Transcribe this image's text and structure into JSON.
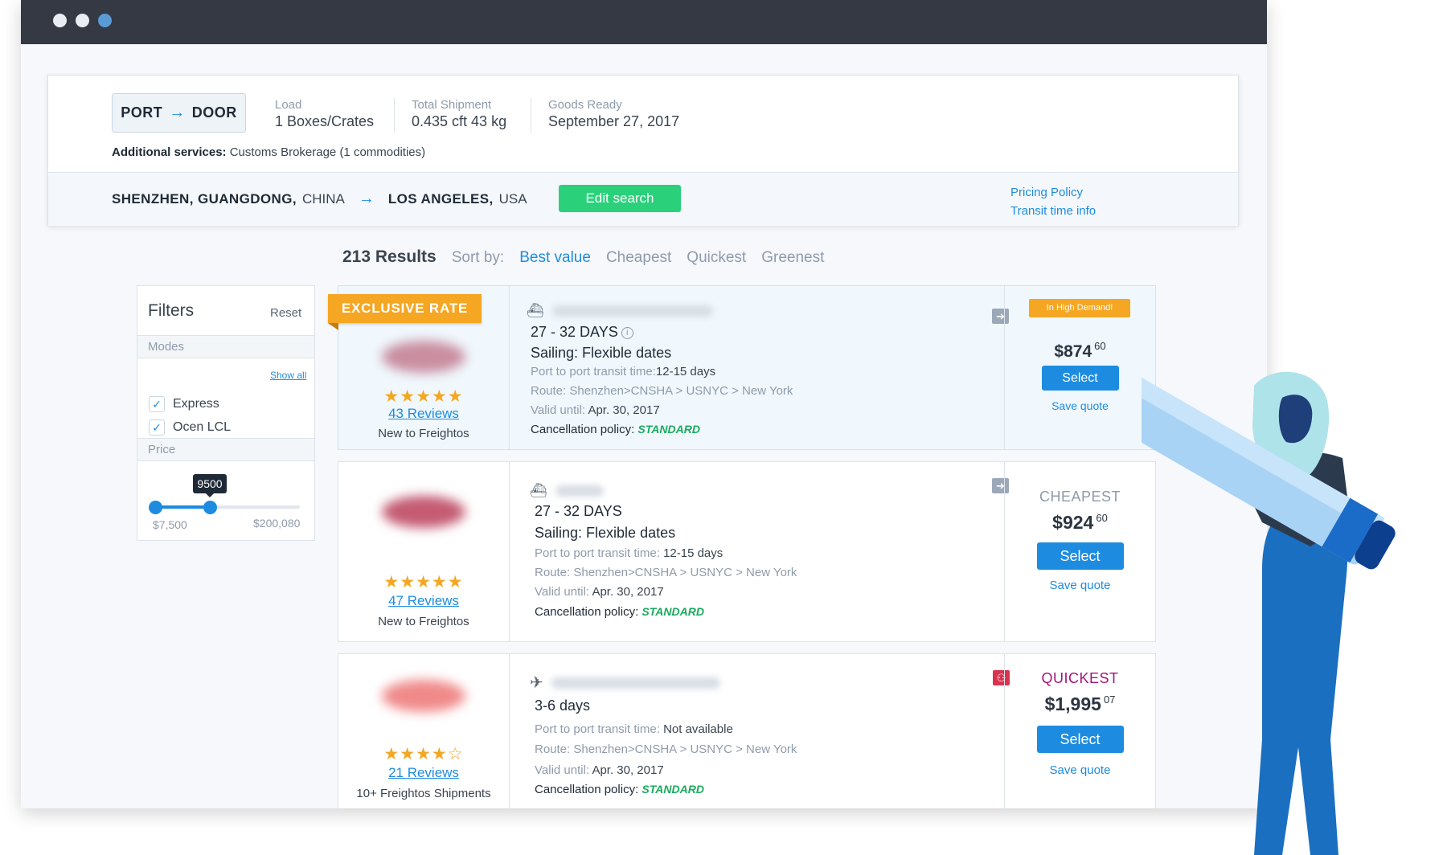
{
  "search": {
    "mode_from": "PORT",
    "mode_to": "DOOR",
    "load_label": "Load",
    "load_value": "1 Boxes/Crates",
    "shipment_label": "Total Shipment",
    "shipment_value": "0.435 cft 43 kg",
    "ready_label": "Goods Ready",
    "ready_value": "September 27, 2017",
    "additional_label": "Additional services:",
    "additional_value": "Customs Brokerage (1 commodities)",
    "origin_city": "SHENZHEN, GUANGDONG,",
    "origin_country": "CHINA",
    "dest_city": "LOS ANGELES,",
    "dest_country": "USA",
    "edit_label": "Edit search",
    "pricing_policy": "Pricing Policy",
    "transit_info": "Transit time info"
  },
  "results": {
    "count": "213 Results",
    "sort_label": "Sort by:",
    "sort_options": [
      "Best value",
      "Cheapest",
      "Quickest",
      "Greenest"
    ],
    "active_sort": "Best value"
  },
  "filters": {
    "title": "Filters",
    "reset": "Reset",
    "modes_label": "Modes",
    "show_all": "Show all",
    "modes": [
      {
        "label": "Express",
        "checked": true
      },
      {
        "label": "Ocen LCL",
        "checked": true
      }
    ],
    "price_label": "Price",
    "price_tooltip": "9500",
    "price_min": "$7,500",
    "price_max": "$200,080",
    "price_value": 9500
  },
  "offers": [
    {
      "ribbon": "EXCLUSIVE RATE",
      "stars": "★★★★★",
      "reviews": "43 Reviews",
      "seller_note": "New to Freightos",
      "days": "27 - 32 DAYS",
      "sailing": "Sailing: Flexible dates",
      "transit_label": "Port to port transit time:",
      "transit_value": "12-15 days",
      "route": "Route: Shenzhen>CNSHA > USNYC > New York",
      "valid_label": "Valid until:",
      "valid_value": "Apr. 30, 2017",
      "cancel_label": "Cancellation policy:",
      "cancel_value": "STANDARD",
      "badge": "In High Demand!",
      "price_main": "$874",
      "price_cents": "60",
      "select": "Select",
      "save": "Save quote"
    },
    {
      "stars": "★★★★★",
      "reviews": "47 Reviews",
      "seller_note": "New to Freightos",
      "days": "27 - 32 DAYS",
      "sailing": "Sailing: Flexible dates",
      "transit_label": "Port to port transit time:",
      "transit_value": "12-15 days",
      "route": "Route: Shenzhen>CNSHA > USNYC > New York",
      "valid_label": "Valid until:",
      "valid_value": "Apr. 30, 2017",
      "cancel_label": "Cancellation policy:",
      "cancel_value": "STANDARD",
      "tag": "CHEAPEST",
      "price_main": "$924",
      "price_cents": "60",
      "select": "Select",
      "save": "Save quote"
    },
    {
      "stars": "★★★★☆",
      "reviews": "21 Reviews",
      "seller_note": "10+ Freightos Shipments",
      "days": "3-6 days",
      "transit_label": "Port to port transit time:",
      "transit_value": "Not available",
      "route": "Route: Shenzhen>CNSHA > USNYC > New York",
      "valid_label": "Valid until:",
      "valid_value": "Apr. 30, 2017",
      "cancel_label": "Cancellation policy:",
      "cancel_value": "STANDARD",
      "tag": "QUICKEST",
      "price_main": "$1,995",
      "price_cents": "07",
      "select": "Select",
      "save": "Save quote"
    }
  ],
  "icons": {
    "route_arrow": "arrow-right-icon",
    "ship": "ship-icon",
    "plane": "plane-icon",
    "check": "check-icon",
    "info": "info-icon",
    "star": "star-icon"
  },
  "colors": {
    "accent": "#1d8ce0",
    "success": "#2ad17a",
    "warning": "#f5a623",
    "titlebar": "#343944",
    "quickest": "#a0167a"
  }
}
